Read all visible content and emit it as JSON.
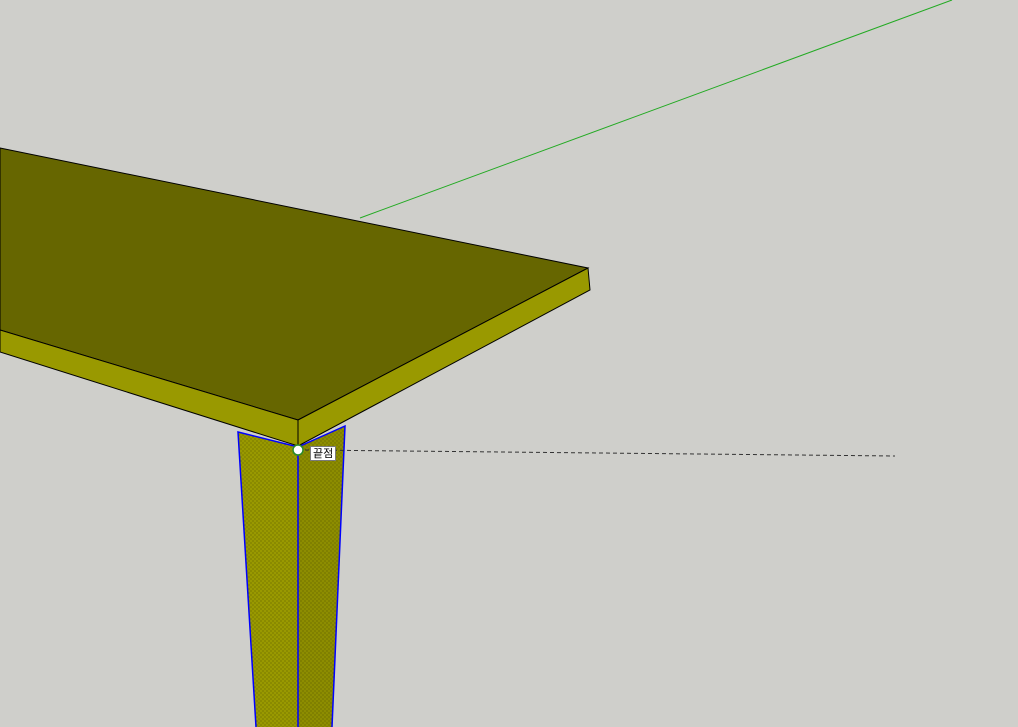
{
  "viewport": {
    "background": "#cfcfcb"
  },
  "model": {
    "table_top_color": "#666600",
    "table_edge_color": "#999900",
    "leg_color": "#999900",
    "leg_selection_color": "#0000ff"
  },
  "axes": {
    "green_axis_color": "#22aa22"
  },
  "inference": {
    "tooltip": "끝점",
    "point_icon": "endpoint-icon",
    "point_color": "#2a8a2a",
    "guide_line_style": "dashed"
  }
}
